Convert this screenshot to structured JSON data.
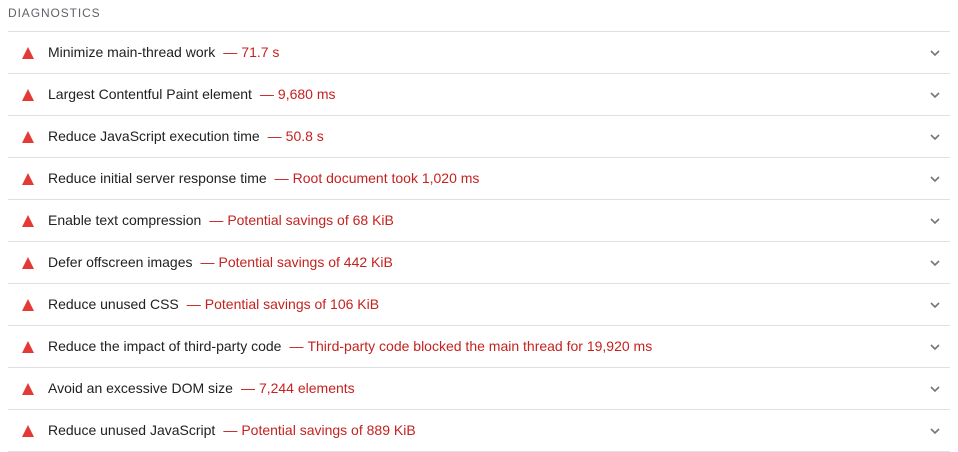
{
  "section": {
    "title": "DIAGNOSTICS"
  },
  "colors": {
    "fail": "#e53935",
    "display_value": "#c5221f",
    "divider": "#e0e0e0",
    "chevron": "#757575"
  },
  "icons": {
    "status": "warning-triangle-icon",
    "expand": "chevron-down-icon"
  },
  "audits": [
    {
      "title": "Minimize main-thread work",
      "separator": "—",
      "display": "71.7 s"
    },
    {
      "title": "Largest Contentful Paint element",
      "separator": "—",
      "display": "9,680 ms"
    },
    {
      "title": "Reduce JavaScript execution time",
      "separator": "—",
      "display": "50.8 s"
    },
    {
      "title": "Reduce initial server response time",
      "separator": "—",
      "display": "Root document took 1,020 ms"
    },
    {
      "title": "Enable text compression",
      "separator": "—",
      "display": "Potential savings of 68 KiB"
    },
    {
      "title": "Defer offscreen images",
      "separator": "—",
      "display": "Potential savings of 442 KiB"
    },
    {
      "title": "Reduce unused CSS",
      "separator": "—",
      "display": "Potential savings of 106 KiB"
    },
    {
      "title": "Reduce the impact of third-party code",
      "separator": "—",
      "display": "Third-party code blocked the main thread for 19,920 ms"
    },
    {
      "title": "Avoid an excessive DOM size",
      "separator": "—",
      "display": "7,244 elements"
    },
    {
      "title": "Reduce unused JavaScript",
      "separator": "—",
      "display": "Potential savings of 889 KiB"
    }
  ]
}
